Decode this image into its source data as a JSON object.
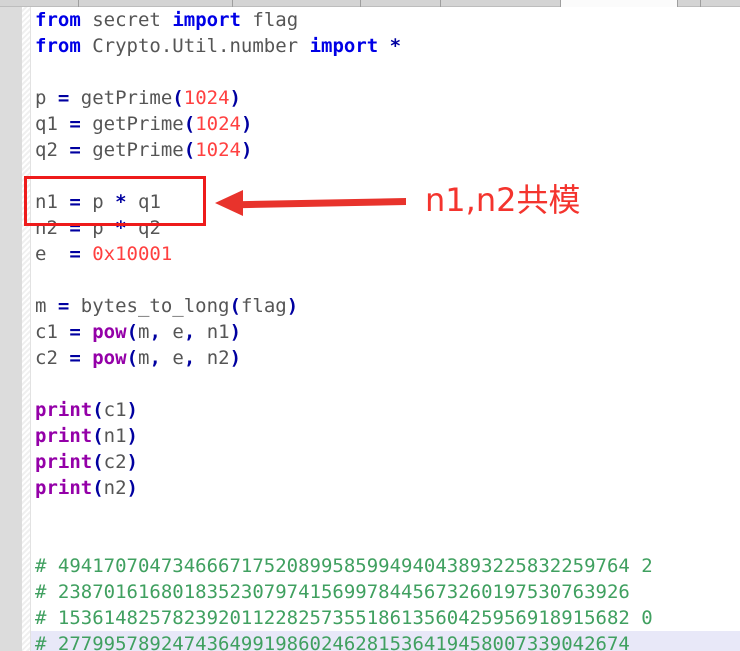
{
  "window": {
    "tabstrip_label": "browser-tab-strip"
  },
  "editor": {
    "language": "python",
    "colors": {
      "keyword": "#0000e6",
      "operator": "#0000a0",
      "number": "#ff4040",
      "builtin": "#9400a8",
      "comment": "#40a060",
      "identifier": "#555555",
      "current_line_highlight": "#e8e8f8",
      "gutter": "#dcdcdc",
      "background": "#ffffff"
    },
    "lines": [
      {
        "id": 1,
        "blank": false,
        "current": false,
        "tokens": [
          {
            "t": "from",
            "c": "kw"
          },
          {
            "t": " ",
            "c": "plain"
          },
          {
            "t": "secret",
            "c": "plain"
          },
          {
            "t": " ",
            "c": "plain"
          },
          {
            "t": "import",
            "c": "kw"
          },
          {
            "t": " ",
            "c": "plain"
          },
          {
            "t": "flag",
            "c": "plain"
          }
        ]
      },
      {
        "id": 2,
        "blank": false,
        "current": false,
        "tokens": [
          {
            "t": "from",
            "c": "kw"
          },
          {
            "t": " ",
            "c": "plain"
          },
          {
            "t": "Crypto.Util.number",
            "c": "plain"
          },
          {
            "t": " ",
            "c": "plain"
          },
          {
            "t": "import",
            "c": "kw"
          },
          {
            "t": " ",
            "c": "plain"
          },
          {
            "t": "*",
            "c": "op"
          }
        ]
      },
      {
        "id": 3,
        "blank": true,
        "current": false,
        "tokens": []
      },
      {
        "id": 4,
        "blank": false,
        "current": false,
        "tokens": [
          {
            "t": "p ",
            "c": "plain"
          },
          {
            "t": "=",
            "c": "op"
          },
          {
            "t": " getPrime",
            "c": "plain"
          },
          {
            "t": "(",
            "c": "op"
          },
          {
            "t": "1024",
            "c": "num"
          },
          {
            "t": ")",
            "c": "op"
          }
        ]
      },
      {
        "id": 5,
        "blank": false,
        "current": false,
        "tokens": [
          {
            "t": "q1 ",
            "c": "plain"
          },
          {
            "t": "=",
            "c": "op"
          },
          {
            "t": " getPrime",
            "c": "plain"
          },
          {
            "t": "(",
            "c": "op"
          },
          {
            "t": "1024",
            "c": "num"
          },
          {
            "t": ")",
            "c": "op"
          }
        ]
      },
      {
        "id": 6,
        "blank": false,
        "current": false,
        "tokens": [
          {
            "t": "q2 ",
            "c": "plain"
          },
          {
            "t": "=",
            "c": "op"
          },
          {
            "t": " getPrime",
            "c": "plain"
          },
          {
            "t": "(",
            "c": "op"
          },
          {
            "t": "1024",
            "c": "num"
          },
          {
            "t": ")",
            "c": "op"
          }
        ]
      },
      {
        "id": 7,
        "blank": true,
        "current": false,
        "tokens": []
      },
      {
        "id": 8,
        "blank": false,
        "current": false,
        "tokens": [
          {
            "t": "n1 ",
            "c": "plain"
          },
          {
            "t": "=",
            "c": "op"
          },
          {
            "t": " p ",
            "c": "plain"
          },
          {
            "t": "*",
            "c": "op"
          },
          {
            "t": " q1",
            "c": "plain"
          }
        ]
      },
      {
        "id": 9,
        "blank": false,
        "current": false,
        "tokens": [
          {
            "t": "n2 ",
            "c": "plain"
          },
          {
            "t": "=",
            "c": "op"
          },
          {
            "t": " p ",
            "c": "plain"
          },
          {
            "t": "*",
            "c": "op"
          },
          {
            "t": " q2",
            "c": "plain"
          }
        ]
      },
      {
        "id": 10,
        "blank": false,
        "current": false,
        "tokens": [
          {
            "t": "e  ",
            "c": "plain"
          },
          {
            "t": "=",
            "c": "op"
          },
          {
            "t": " ",
            "c": "plain"
          },
          {
            "t": "0x10001",
            "c": "num"
          }
        ]
      },
      {
        "id": 11,
        "blank": true,
        "current": false,
        "tokens": []
      },
      {
        "id": 12,
        "blank": false,
        "current": false,
        "tokens": [
          {
            "t": "m ",
            "c": "plain"
          },
          {
            "t": "=",
            "c": "op"
          },
          {
            "t": " bytes_to_long",
            "c": "plain"
          },
          {
            "t": "(",
            "c": "op"
          },
          {
            "t": "flag",
            "c": "plain"
          },
          {
            "t": ")",
            "c": "op"
          }
        ]
      },
      {
        "id": 13,
        "blank": false,
        "current": false,
        "tokens": [
          {
            "t": "c1 ",
            "c": "plain"
          },
          {
            "t": "=",
            "c": "op"
          },
          {
            "t": " ",
            "c": "plain"
          },
          {
            "t": "pow",
            "c": "builtin"
          },
          {
            "t": "(",
            "c": "op"
          },
          {
            "t": "m",
            "c": "plain"
          },
          {
            "t": ",",
            "c": "op"
          },
          {
            "t": " e",
            "c": "plain"
          },
          {
            "t": ",",
            "c": "op"
          },
          {
            "t": " n1",
            "c": "plain"
          },
          {
            "t": ")",
            "c": "op"
          }
        ]
      },
      {
        "id": 14,
        "blank": false,
        "current": false,
        "tokens": [
          {
            "t": "c2 ",
            "c": "plain"
          },
          {
            "t": "=",
            "c": "op"
          },
          {
            "t": " ",
            "c": "plain"
          },
          {
            "t": "pow",
            "c": "builtin"
          },
          {
            "t": "(",
            "c": "op"
          },
          {
            "t": "m",
            "c": "plain"
          },
          {
            "t": ",",
            "c": "op"
          },
          {
            "t": " e",
            "c": "plain"
          },
          {
            "t": ",",
            "c": "op"
          },
          {
            "t": " n2",
            "c": "plain"
          },
          {
            "t": ")",
            "c": "op"
          }
        ]
      },
      {
        "id": 15,
        "blank": true,
        "current": false,
        "tokens": []
      },
      {
        "id": 16,
        "blank": false,
        "current": false,
        "tokens": [
          {
            "t": "print",
            "c": "builtin"
          },
          {
            "t": "(",
            "c": "op"
          },
          {
            "t": "c1",
            "c": "plain"
          },
          {
            "t": ")",
            "c": "op"
          }
        ]
      },
      {
        "id": 17,
        "blank": false,
        "current": false,
        "tokens": [
          {
            "t": "print",
            "c": "builtin"
          },
          {
            "t": "(",
            "c": "op"
          },
          {
            "t": "n1",
            "c": "plain"
          },
          {
            "t": ")",
            "c": "op"
          }
        ]
      },
      {
        "id": 18,
        "blank": false,
        "current": false,
        "tokens": [
          {
            "t": "print",
            "c": "builtin"
          },
          {
            "t": "(",
            "c": "op"
          },
          {
            "t": "c2",
            "c": "plain"
          },
          {
            "t": ")",
            "c": "op"
          }
        ]
      },
      {
        "id": 19,
        "blank": false,
        "current": false,
        "tokens": [
          {
            "t": "print",
            "c": "builtin"
          },
          {
            "t": "(",
            "c": "op"
          },
          {
            "t": "n2",
            "c": "plain"
          },
          {
            "t": ")",
            "c": "op"
          }
        ]
      },
      {
        "id": 20,
        "blank": true,
        "current": false,
        "tokens": []
      },
      {
        "id": 21,
        "blank": true,
        "current": false,
        "tokens": []
      },
      {
        "id": 22,
        "blank": false,
        "current": false,
        "tokens": [
          {
            "t": "# 49417070473466671752089958599494043893225832259764 2",
            "c": "comment"
          }
        ]
      },
      {
        "id": 23,
        "blank": false,
        "current": false,
        "tokens": [
          {
            "t": "# 23870161680183523079741569978445673260197530763926",
            "c": "comment"
          }
        ]
      },
      {
        "id": 24,
        "blank": false,
        "current": false,
        "tokens": [
          {
            "t": "# 15361482578239201122825735518613560425956918915682 0",
            "c": "comment"
          }
        ]
      },
      {
        "id": 25,
        "blank": false,
        "current": true,
        "tokens": [
          {
            "t": "# 27799578924743649919860246281536419458007339042674",
            "c": "comment"
          }
        ]
      }
    ]
  },
  "annotation": {
    "label": "n1,n2共模",
    "color": "#f4342e",
    "box_target": "n1-n2-assignment-lines",
    "arrow": "left-pointing-arrow"
  }
}
